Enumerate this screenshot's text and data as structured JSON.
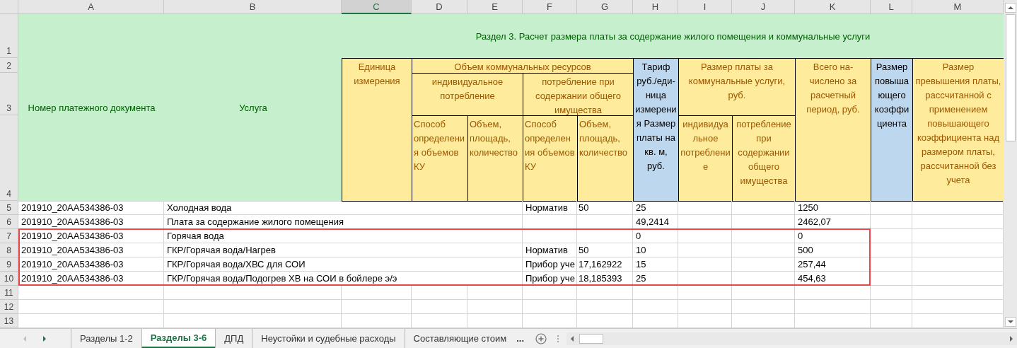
{
  "columns": [
    {
      "letter": "A",
      "selected": false
    },
    {
      "letter": "B",
      "selected": false
    },
    {
      "letter": "C",
      "selected": true
    },
    {
      "letter": "D",
      "selected": false
    },
    {
      "letter": "E",
      "selected": false
    },
    {
      "letter": "F",
      "selected": false
    },
    {
      "letter": "G",
      "selected": false
    },
    {
      "letter": "H",
      "selected": false
    },
    {
      "letter": "I",
      "selected": false
    },
    {
      "letter": "J",
      "selected": false
    },
    {
      "letter": "K",
      "selected": false
    },
    {
      "letter": "L",
      "selected": false
    },
    {
      "letter": "M",
      "selected": false
    }
  ],
  "header_row_numbers": [
    "1",
    "2",
    "3",
    "4"
  ],
  "header": {
    "doc_number": "Номер платежного документа",
    "service": "Услуга",
    "title": "Раздел 3. Расчет размера платы за содержание жилого помещения и коммунальные услуги",
    "unit": "Единица измерения",
    "volume": "Объем коммунальных ресурсов",
    "individual": "индивидуальное потребление",
    "common": "потребление при содержании общего имущества",
    "method_individual": "Способ определения объемов КУ",
    "amount_individual": "Объем, площадь, количество",
    "method_common": "Способ определения объемов КУ",
    "amount_common": "Объем, площадь, количество",
    "tariff": "Тариф руб./еди-ница измерения Размер платы на кв. м, руб.",
    "payment": "Размер платы за коммунальные услуги, руб.",
    "payment_individual": "индивидуальное потребление",
    "payment_common": "потребление при содержании общего имущества",
    "total": "Всего на-числено за расчетный период, руб.",
    "coefficient": "Размер повышающего коэффициента",
    "excess": "Размер превышения платы, рассчитанной с применением повышающего коэффициента над размером платы, рассчитанной без учета"
  },
  "rows": [
    {
      "number": "5",
      "doc": "201910_20АА534386-03",
      "service": "Холодная вода",
      "method": "Норматив",
      "volume": "50",
      "tariff": "25",
      "total": "1250",
      "highlighted": false
    },
    {
      "number": "6",
      "doc": "201910_20АА534386-03",
      "service": "Плата за содержание жилого помещения",
      "tariff": "49,2414",
      "total": "2462,07",
      "highlighted": false
    },
    {
      "number": "7",
      "doc": "201910_20АА534386-03",
      "service": "Горячая вода",
      "tariff": "0",
      "total": "0",
      "highlighted": true
    },
    {
      "number": "8",
      "doc": "201910_20АА534386-03",
      "service": "ГКР/Горячая вода/Нагрев",
      "method": "Норматив",
      "volume": "50",
      "tariff": "10",
      "total": "500",
      "highlighted": true
    },
    {
      "number": "9",
      "doc": "201910_20АА534386-03",
      "service": "ГКР/Горячая вода/ХВС для СОИ",
      "method": "Прибор уче",
      "volume": "17,162922",
      "tariff": "15",
      "total": "257,44",
      "highlighted": true
    },
    {
      "number": "10",
      "doc": "201910_20АА534386-03",
      "service": "ГКР/Горячая вода/Подогрев ХВ на СОИ в бойлере э/э",
      "method": "Прибор уче",
      "volume": "18,185393",
      "tariff": "25",
      "total": "454,63",
      "highlighted": true
    }
  ],
  "empty_rows": [
    "11",
    "12",
    "13"
  ],
  "sheet_tabs": [
    {
      "label": "Разделы 1-2",
      "selected": false
    },
    {
      "label": "Разделы 3-6",
      "selected": true
    },
    {
      "label": "ДПД",
      "selected": false
    },
    {
      "label": "Неустойки и судебные расходы",
      "selected": false
    },
    {
      "label": "Составляющие стоим",
      "selected": false
    }
  ],
  "tab_overflow": "..."
}
